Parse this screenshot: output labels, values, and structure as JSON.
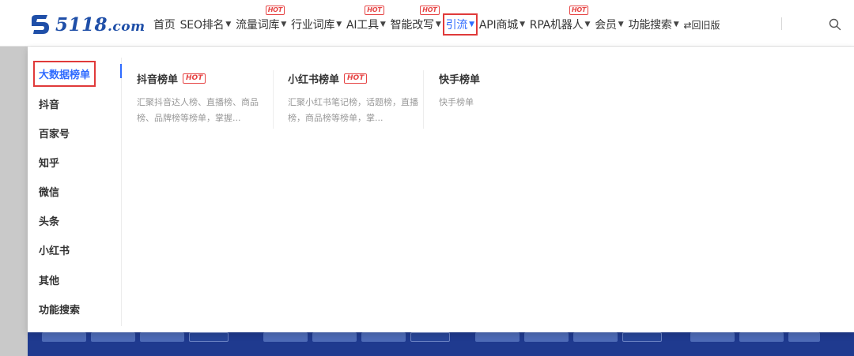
{
  "brand": {
    "name": "5118",
    "suffix": ".com",
    "color": "#1f4fa8"
  },
  "nav": {
    "items": [
      {
        "label": "首页",
        "caret": false,
        "hot": ""
      },
      {
        "label": "SEO排名",
        "caret": true,
        "hot": ""
      },
      {
        "label": "流量词库",
        "caret": true,
        "hot": "HOT"
      },
      {
        "label": "行业词库",
        "caret": true,
        "hot": ""
      },
      {
        "label": "AI工具",
        "caret": true,
        "hot": "HOT"
      },
      {
        "label": "智能改写",
        "caret": true,
        "hot": "HOT"
      },
      {
        "label": "引流",
        "caret": true,
        "hot": "",
        "active": true
      },
      {
        "label": "API商城",
        "caret": true,
        "hot": ""
      },
      {
        "label": "RPA机器人",
        "caret": true,
        "hot": "HOT"
      },
      {
        "label": "会员",
        "caret": true,
        "hot": ""
      },
      {
        "label": "功能搜索",
        "caret": true,
        "hot": ""
      }
    ],
    "switch_label": "⇄回旧版",
    "search_icon": "search-icon",
    "accent": "#2f6bff",
    "hot_color": "#e64545"
  },
  "dropdown": {
    "sidebar": [
      "大数据榜单",
      "抖音",
      "百家号",
      "知乎",
      "微信",
      "头条",
      "小红书",
      "其他",
      "功能搜索"
    ],
    "active_sidebar": "大数据榜单",
    "columns": [
      {
        "title": "抖音榜单",
        "hot": "HOT",
        "desc": "汇聚抖音达人榜、直播榜、商品榜、品牌榜等榜单，掌握..."
      },
      {
        "title": "小红书榜单",
        "hot": "HOT",
        "desc": "汇聚小红书笔记榜，话题榜，直播榜，商品榜等榜单，掌..."
      },
      {
        "title": "快手榜单",
        "hot": "",
        "desc": "快手榜单"
      }
    ]
  }
}
